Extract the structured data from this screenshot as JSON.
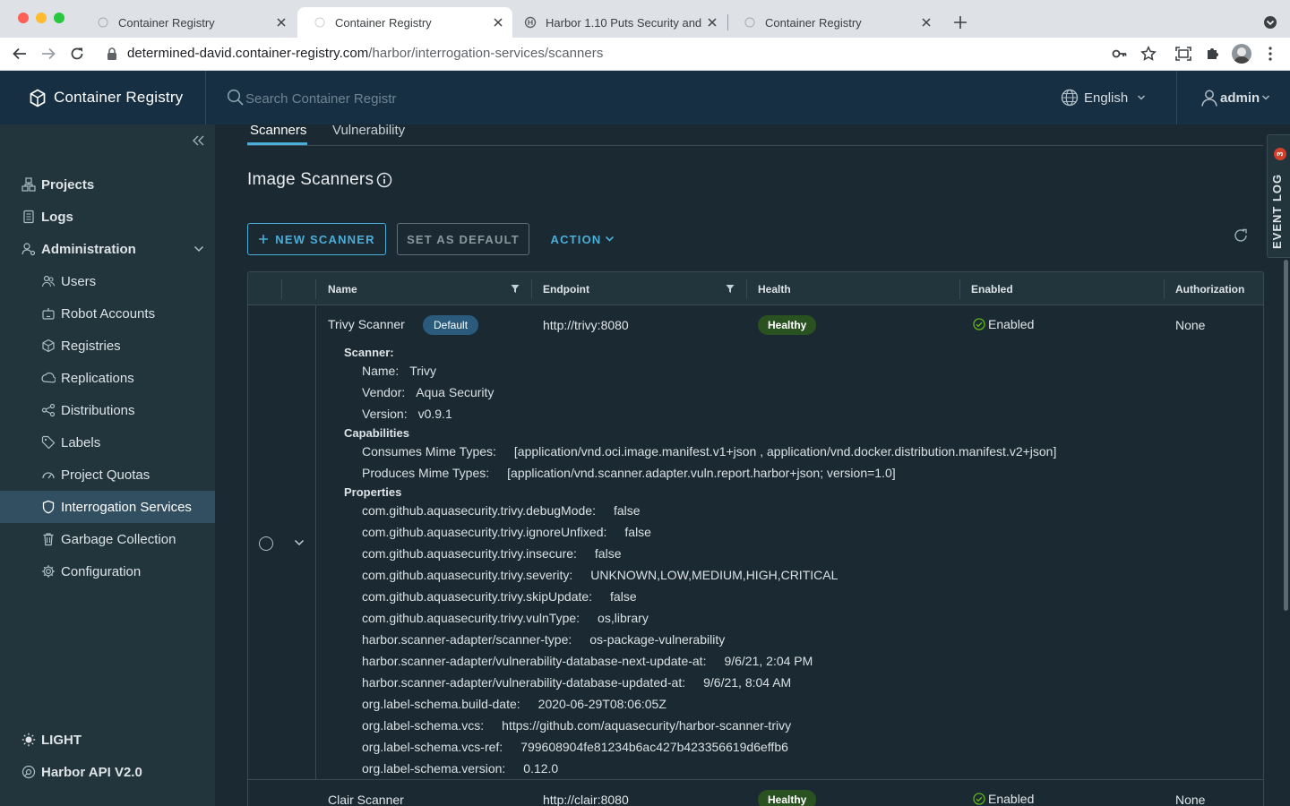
{
  "browser": {
    "tabs": [
      {
        "title": "Container Registry",
        "active": false
      },
      {
        "title": "Container Registry",
        "active": true
      },
      {
        "title": "Harbor 1.10 Puts Security and I",
        "active": false
      },
      {
        "title": "Container Registry",
        "active": false
      }
    ],
    "url_host": "determined-david.container-registry.com",
    "url_path": "/harbor/interrogation-services/scanners"
  },
  "header": {
    "brand": "Container Registry",
    "search_placeholder": "Search Container Registr",
    "language": "English",
    "user": "admin"
  },
  "sidebar": {
    "items": [
      {
        "label": "Projects",
        "icon": "projects-icon",
        "level": "top"
      },
      {
        "label": "Logs",
        "icon": "logs-icon",
        "level": "top"
      },
      {
        "label": "Administration",
        "icon": "administration-icon",
        "level": "top"
      },
      {
        "label": "Users",
        "icon": "users-icon",
        "level": "sub"
      },
      {
        "label": "Robot Accounts",
        "icon": "robot-icon",
        "level": "sub"
      },
      {
        "label": "Registries",
        "icon": "registries-icon",
        "level": "sub"
      },
      {
        "label": "Replications",
        "icon": "replications-icon",
        "level": "sub"
      },
      {
        "label": "Distributions",
        "icon": "distributions-icon",
        "level": "sub"
      },
      {
        "label": "Labels",
        "icon": "labels-icon",
        "level": "sub"
      },
      {
        "label": "Project Quotas",
        "icon": "quotas-icon",
        "level": "sub"
      },
      {
        "label": "Interrogation Services",
        "icon": "shield-icon",
        "level": "sub",
        "selected": true
      },
      {
        "label": "Garbage Collection",
        "icon": "trash-icon",
        "level": "sub"
      },
      {
        "label": "Configuration",
        "icon": "gear-icon",
        "level": "sub"
      }
    ],
    "theme_toggle": "LIGHT",
    "api_link": "Harbor API V2.0"
  },
  "main": {
    "tabs": [
      "Scanners",
      "Vulnerability"
    ],
    "title": "Image Scanners",
    "buttons": {
      "new_scanner": "NEW SCANNER",
      "set_default": "SET AS DEFAULT",
      "action": "ACTION"
    },
    "columns": [
      "Name",
      "Endpoint",
      "Health",
      "Enabled",
      "Authorization"
    ],
    "rows": [
      {
        "name": "Trivy Scanner",
        "badge": "Default",
        "endpoint": "http://trivy:8080",
        "health": "Healthy",
        "enabled": "Enabled",
        "auth": "None",
        "details": {
          "scanner_heading": "Scanner:",
          "scanner": [
            {
              "k": "Name:",
              "v": "Trivy"
            },
            {
              "k": "Vendor:",
              "v": "Aqua Security"
            },
            {
              "k": "Version:",
              "v": "v0.9.1"
            }
          ],
          "capabilities_heading": "Capabilities",
          "capabilities": [
            {
              "k": "Consumes Mime Types:",
              "v": "[application/vnd.oci.image.manifest.v1+json , application/vnd.docker.distribution.manifest.v2+json]"
            },
            {
              "k": "Produces Mime Types:",
              "v": "[application/vnd.scanner.adapter.vuln.report.harbor+json; version=1.0]"
            }
          ],
          "properties_heading": "Properties",
          "properties": [
            {
              "k": "com.github.aquasecurity.trivy.debugMode:",
              "v": "false"
            },
            {
              "k": "com.github.aquasecurity.trivy.ignoreUnfixed:",
              "v": "false"
            },
            {
              "k": "com.github.aquasecurity.trivy.insecure:",
              "v": "false"
            },
            {
              "k": "com.github.aquasecurity.trivy.severity:",
              "v": "UNKNOWN,LOW,MEDIUM,HIGH,CRITICAL"
            },
            {
              "k": "com.github.aquasecurity.trivy.skipUpdate:",
              "v": "false"
            },
            {
              "k": "com.github.aquasecurity.trivy.vulnType:",
              "v": "os,library"
            },
            {
              "k": "harbor.scanner-adapter/scanner-type:",
              "v": "os-package-vulnerability"
            },
            {
              "k": "harbor.scanner-adapter/vulnerability-database-next-update-at:",
              "v": "9/6/21, 2:04 PM"
            },
            {
              "k": "harbor.scanner-adapter/vulnerability-database-updated-at:",
              "v": "9/6/21, 8:04 AM"
            },
            {
              "k": "org.label-schema.build-date:",
              "v": "2020-06-29T08:06:05Z"
            },
            {
              "k": "org.label-schema.vcs:",
              "v": "https://github.com/aquasecurity/harbor-scanner-trivy"
            },
            {
              "k": "org.label-schema.vcs-ref:",
              "v": "799608904fe81234b6ac427b423356619d6effb6"
            },
            {
              "k": "org.label-schema.version:",
              "v": "0.12.0"
            }
          ]
        }
      },
      {
        "name": "Clair Scanner",
        "endpoint": "http://clair:8080",
        "health": "Healthy",
        "enabled": "Enabled",
        "auth": "None"
      }
    ]
  },
  "event_log": {
    "label": "EVENT LOG",
    "count": "3"
  },
  "colors": {
    "accent": "#4aaed9",
    "header_bg": "#172f42",
    "sidebar_bg": "#22343c",
    "content_bg": "#1b2a32",
    "healthy": "#2a5221",
    "default_badge": "#2b5b7c"
  }
}
